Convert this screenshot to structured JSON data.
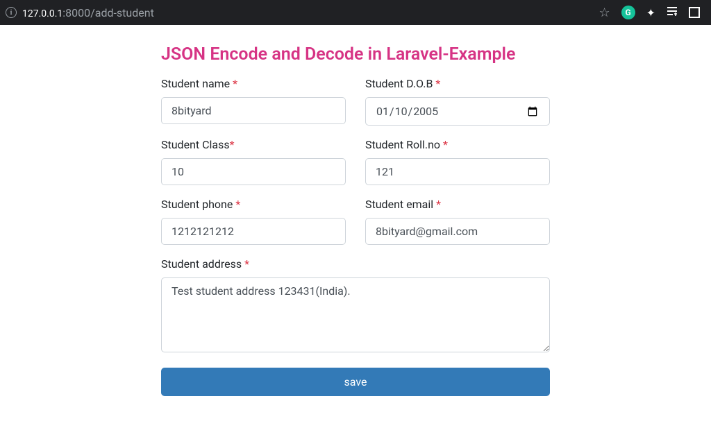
{
  "browser": {
    "url_host": "127.0.0.1",
    "url_port": ":8000",
    "url_path": "/add-student"
  },
  "page": {
    "title": "JSON Encode and Decode in Laravel-Example"
  },
  "form": {
    "name": {
      "label": "Student name ",
      "value": "8bityard"
    },
    "dob": {
      "label": "Student D.O.B ",
      "value": "2005-01-10"
    },
    "class": {
      "label": "Student Class",
      "value": "10"
    },
    "rollno": {
      "label": "Student Roll.no ",
      "value": "121"
    },
    "phone": {
      "label": "Student phone ",
      "value": "1212121212"
    },
    "email": {
      "label": "Student email ",
      "value": "8bityard@gmail.com"
    },
    "address": {
      "label": "Student address ",
      "value": "Test student address 123431(India)."
    },
    "submit_label": "save"
  }
}
